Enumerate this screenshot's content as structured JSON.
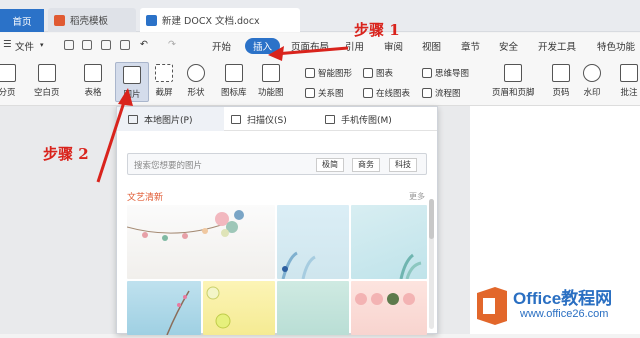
{
  "tabs": {
    "home": "首页",
    "template": "稻壳模板",
    "doc": "新建 DOCX 文档.docx"
  },
  "menu": {
    "file": "文件",
    "items": [
      "开始",
      "插入",
      "页面布局",
      "引用",
      "审阅",
      "视图",
      "章节",
      "安全",
      "开发工具",
      "特色功能"
    ]
  },
  "ribbon": {
    "page": "分页",
    "blank": "空白页",
    "table": "表格",
    "picture": "图片",
    "screenshot": "截屏",
    "shape": "形状",
    "iconlib": "图标库",
    "funcchart": "功能图",
    "smartgraphic": "智能图形",
    "relation": "关系图",
    "chart": "图表",
    "onlinechart": "在线图表",
    "mindmap": "思维导图",
    "flowchart": "流程图",
    "headerfooter": "页眉和页脚",
    "pagenum": "页码",
    "watermark": "水印",
    "comment": "批注"
  },
  "popup": {
    "tabs": [
      "本地图片(P)",
      "扫描仪(S)",
      "手机传图(M)"
    ],
    "search_placeholder": "搜索您想要的图片",
    "chips": [
      "极简",
      "商务",
      "科技"
    ],
    "section_title": "文艺清新",
    "more": "更多"
  },
  "annotations": {
    "step1": "步骤 1",
    "step2": "步骤 2"
  },
  "watermark": {
    "title": "Office教程网",
    "url": "www.office26.com"
  },
  "colors": {
    "accent": "#2b72c8",
    "arrow": "#d9231c",
    "section": "#e05a32"
  }
}
